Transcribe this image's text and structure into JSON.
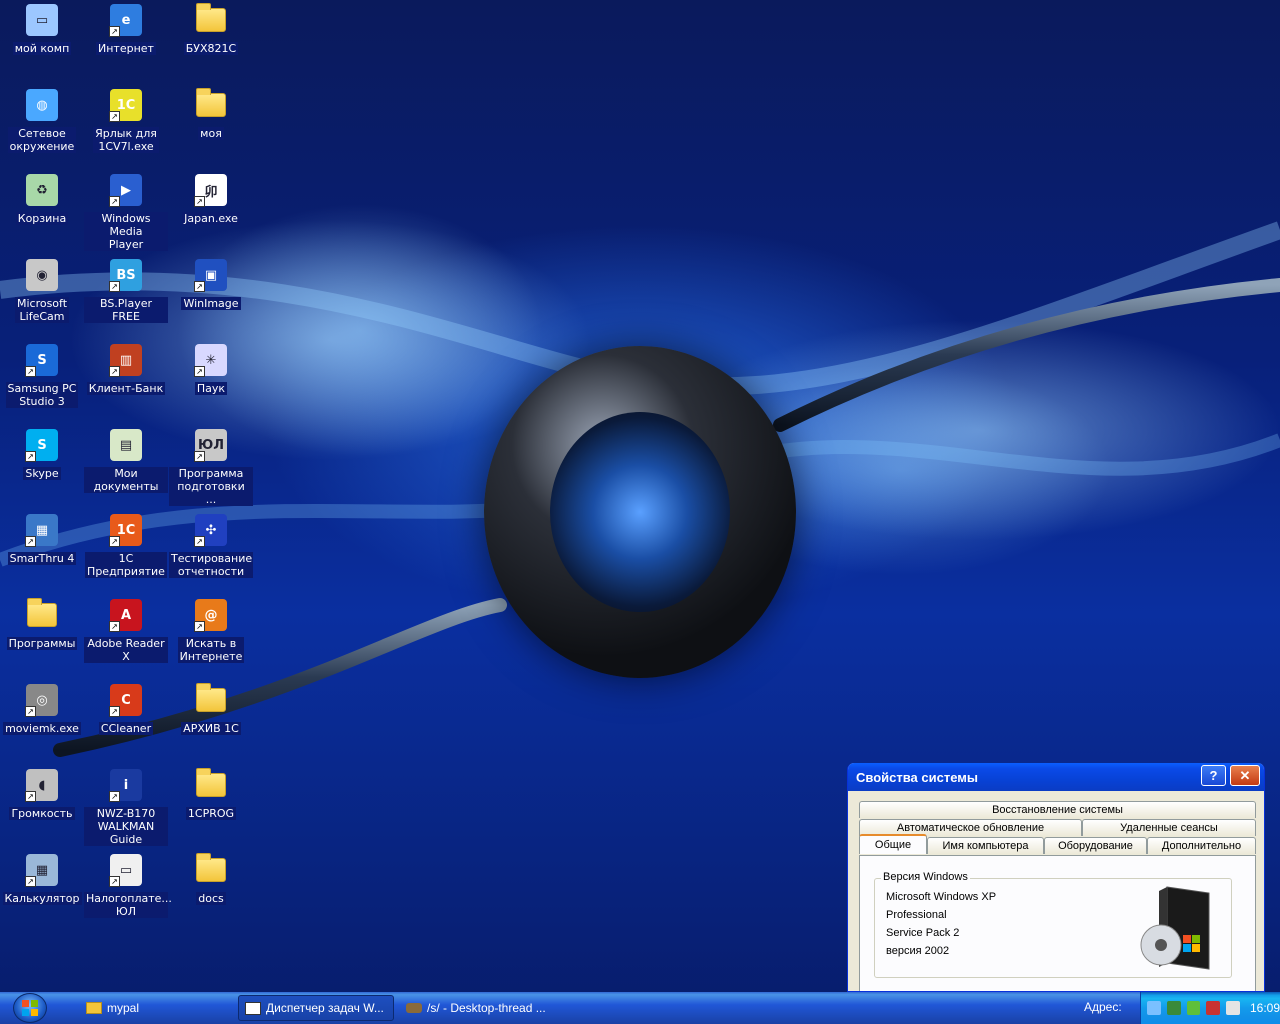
{
  "desktop": {
    "icons": [
      {
        "label": "мой комп",
        "kind": "computer"
      },
      {
        "label": "Интернет",
        "kind": "ie"
      },
      {
        "label": "БУХ821С",
        "kind": "folder"
      },
      {
        "label": "Сетевое\nокружение",
        "kind": "network"
      },
      {
        "label": "Ярлык для\n1CV7l.exe",
        "kind": "app1c7"
      },
      {
        "label": "моя",
        "kind": "folder"
      },
      {
        "label": "Корзина",
        "kind": "recycle"
      },
      {
        "label": "Windows Media\nPlayer",
        "kind": "wmp"
      },
      {
        "label": "Japan.exe",
        "kind": "japan"
      },
      {
        "label": "Microsoft\nLifeCam",
        "kind": "webcam"
      },
      {
        "label": "BS.Player FREE",
        "kind": "bsplayer"
      },
      {
        "label": "WinImage",
        "kind": "winimage"
      },
      {
        "label": "Samsung PC\nStudio 3",
        "kind": "samsung"
      },
      {
        "label": "Клиент-Банк",
        "kind": "bank"
      },
      {
        "label": "Паук",
        "kind": "spider"
      },
      {
        "label": "Skype",
        "kind": "skype"
      },
      {
        "label": "Мои документы",
        "kind": "mydocs"
      },
      {
        "label": "Программа\nподготовки ...",
        "kind": "program"
      },
      {
        "label": "SmarThru 4",
        "kind": "smarthru"
      },
      {
        "label": "1С\nПредприятие",
        "kind": "app1c"
      },
      {
        "label": "Тестирование\nотчетности",
        "kind": "butterfly"
      },
      {
        "label": "Программы",
        "kind": "folder"
      },
      {
        "label": "Adobe Reader X",
        "kind": "adobe"
      },
      {
        "label": "Искать в\nИнтернете",
        "kind": "search"
      },
      {
        "label": "moviemk.exe",
        "kind": "moviemaker"
      },
      {
        "label": "CCleaner",
        "kind": "ccleaner"
      },
      {
        "label": "АРХИВ 1С",
        "kind": "folder"
      },
      {
        "label": "Громкость",
        "kind": "volume"
      },
      {
        "label": "NWZ-B170\nWALKMAN Guide",
        "kind": "walkman"
      },
      {
        "label": "1CPROG",
        "kind": "folder"
      },
      {
        "label": "Калькулятор",
        "kind": "calc"
      },
      {
        "label": "Налогоплате...\nЮЛ",
        "kind": "window"
      },
      {
        "label": "docs",
        "kind": "folder"
      }
    ]
  },
  "system_properties": {
    "title": "Свойства системы",
    "help_label": "?",
    "close_label": "✕",
    "tabs_row1": [
      "Восстановление системы"
    ],
    "tabs_row2": [
      "Автоматическое обновление",
      "Удаленные сеансы"
    ],
    "tabs_row3": [
      "Общие",
      "Имя компьютера",
      "Оборудование",
      "Дополнительно"
    ],
    "active_tab": "Общие",
    "group_title": "Версия Windows",
    "version_lines": [
      "Microsoft Windows XP",
      "Professional",
      "Service Pack 2",
      "версия 2002"
    ]
  },
  "taskbar": {
    "tasks": [
      {
        "label": "mypal",
        "icon": "folder-icon"
      },
      {
        "label": "Диспетчер задач W...",
        "icon": "taskmgr-icon"
      },
      {
        "label": "/s/ - Desktop-thread ...",
        "icon": "browser-icon"
      }
    ],
    "address_label": "Адрес:",
    "clock": "16:09"
  }
}
